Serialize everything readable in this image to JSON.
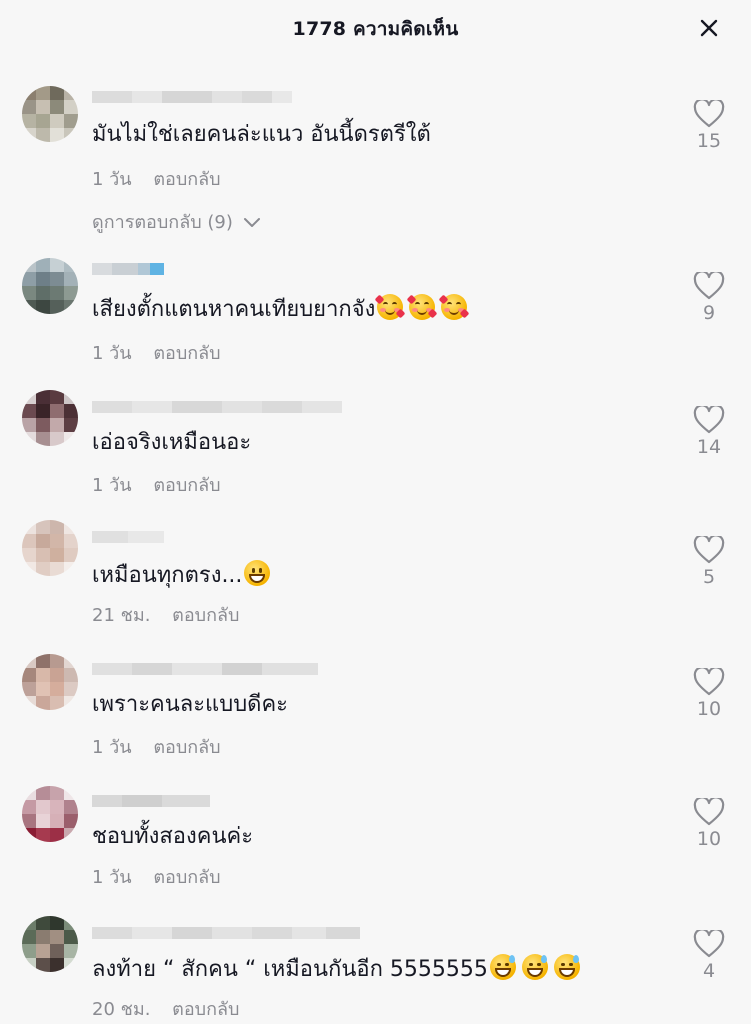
{
  "header": {
    "title": "1778 ความคิดเห็น",
    "close_icon": "close-icon"
  },
  "reply_label": "ตอบกลับ",
  "comments": [
    {
      "text": "มันไม่ใช่เลยคนล่ะแนว อันนี้ดรตรีใต้",
      "time": "1 วัน",
      "likes": "15",
      "view_replies": "ดูการตอบกลับ (9)"
    },
    {
      "text": "เสียงตั้กแตนหาคนเทียบยากจัง",
      "emojis": [
        "smiling-face-with-hearts",
        "smiling-face-with-hearts",
        "smiling-face-with-hearts"
      ],
      "time": "1 วัน",
      "likes": "9"
    },
    {
      "text": "เอ่อจริงเหมือนอะ",
      "time": "1 วัน",
      "likes": "14"
    },
    {
      "text": "เหมือนทุกตรง...",
      "emojis": [
        "grinning-face"
      ],
      "time": "21 ชม.",
      "likes": "5"
    },
    {
      "text": "เพราะคนละแบบดีคะ",
      "time": "1 วัน",
      "likes": "10"
    },
    {
      "text": "ชอบทั้งสองคนค่ะ",
      "time": "1 วัน",
      "likes": "10"
    },
    {
      "text": "ลงท้าย “ สักคน “ เหมือนกันอีก 5555555",
      "emojis": [
        "grinning-face-with-sweat",
        "grinning-face-with-sweat",
        "grinning-face-with-sweat"
      ],
      "time": "20 ชม.",
      "likes": "4"
    }
  ],
  "colors": {
    "background": "#f7f7f7",
    "text_primary": "#161823",
    "text_secondary": "#8a8b91"
  },
  "icons": {
    "like": "heart-outline-icon",
    "expand": "chevron-down-icon"
  }
}
